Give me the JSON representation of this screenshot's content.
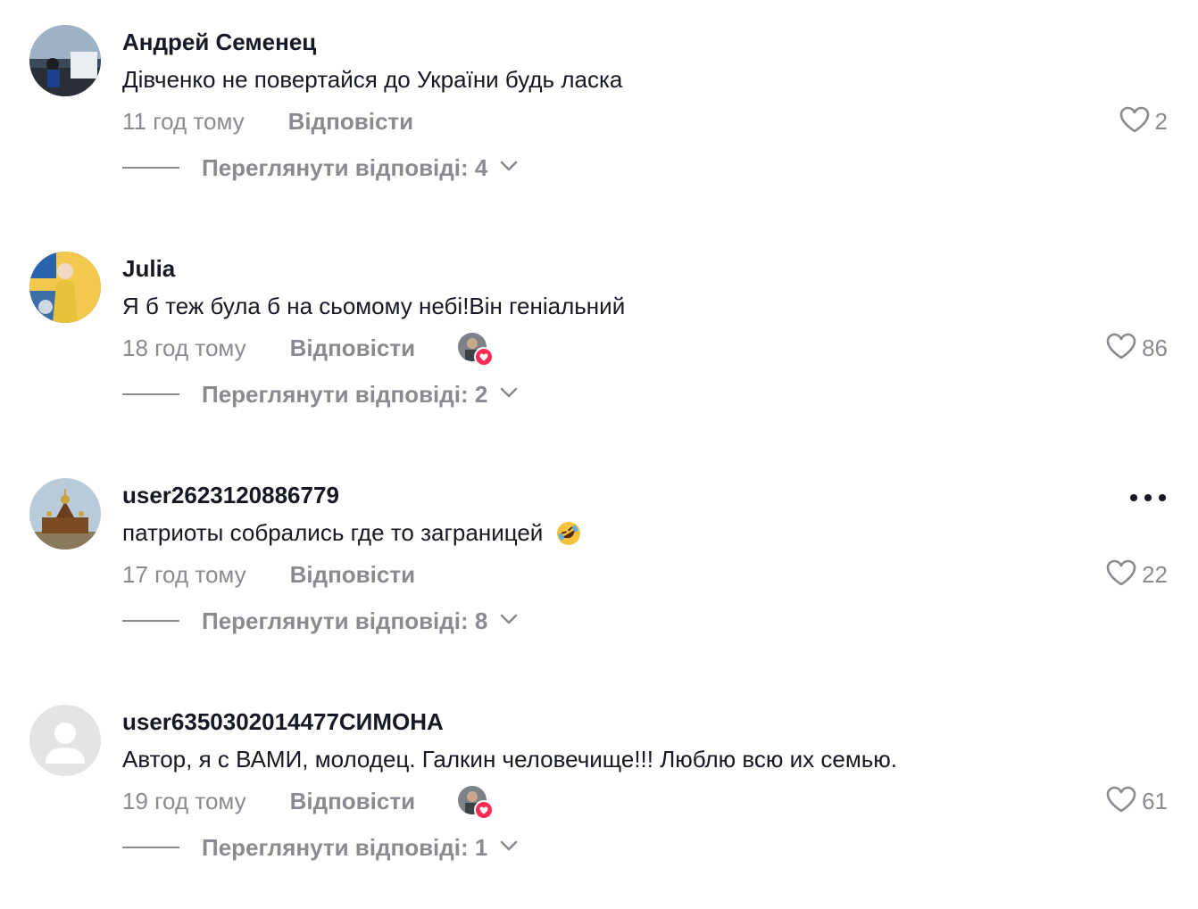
{
  "comments": [
    {
      "username": "Андрей Семенец",
      "text": "Дівченко не повертайся до України будь ласка",
      "time": "11 год тому",
      "reply_label": "Відповісти",
      "likes": "2",
      "view_replies": "Переглянути відповіді: 4",
      "liked_by_author": false
    },
    {
      "username": "Julia",
      "text": "Я б теж була б на сьомому небі!Він геніальний",
      "time": "18 год тому",
      "reply_label": "Відповісти",
      "likes": "86",
      "view_replies": "Переглянути відповіді: 2",
      "liked_by_author": true
    },
    {
      "username": "user2623120886779",
      "text": "патриоты собрались где то заграницей",
      "time": "17 год тому",
      "reply_label": "Відповісти",
      "likes": "22",
      "view_replies": "Переглянути відповіді: 8",
      "liked_by_author": false,
      "emoji": "rolling-on-floor-laughing-emoji"
    },
    {
      "username": "user6350302014477СИМОНА",
      "text": "Автор, я с ВАМИ, молодец. Галкин человечище!!! Люблю всю их семью.",
      "time": "19 год тому",
      "reply_label": "Відповісти",
      "likes": "61",
      "view_replies": "Переглянути відповіді: 1",
      "liked_by_author": true
    }
  ],
  "icons": {
    "like": "heart-outline-icon",
    "expand": "chevron-down-icon",
    "more": "more-options-icon",
    "author_badge": "heart-badge-icon"
  },
  "colors": {
    "text_primary": "#161823",
    "text_secondary": "#8a8b91",
    "accent": "#fe2c55"
  }
}
